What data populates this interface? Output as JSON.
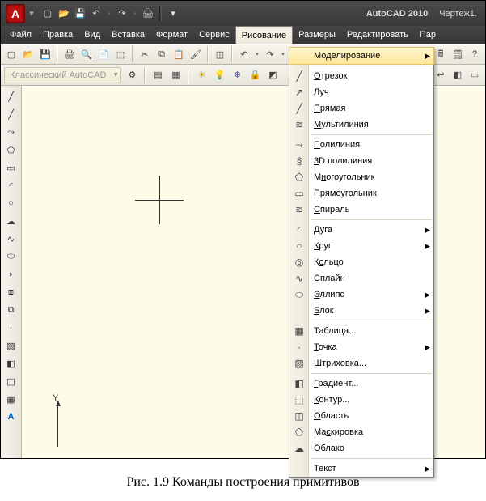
{
  "app_title": "AutoCAD 2010",
  "doc_title": "Чертеж1.",
  "qat": {
    "tooltip_dd": "▾"
  },
  "menu": {
    "items": [
      "Файл",
      "Правка",
      "Вид",
      "Вставка",
      "Формат",
      "Сервис",
      "Рисование",
      "Размеры",
      "Редактировать",
      "Пар"
    ],
    "open_index": 6
  },
  "workspace": {
    "selected": "Классический AutoCAD"
  },
  "dropdown": {
    "groups": [
      {
        "items": [
          {
            "label": "Моделирование",
            "icon": "",
            "submenu": true,
            "hover": true
          }
        ]
      },
      {
        "items": [
          {
            "label": "Отрезок",
            "u": 0,
            "icon": "╱"
          },
          {
            "label": "Луч",
            "u": 2,
            "icon": "↗"
          },
          {
            "label": "Прямая",
            "u": 0,
            "icon": "╱"
          },
          {
            "label": "Мультилиния",
            "u": 0,
            "icon": "≋"
          }
        ]
      },
      {
        "items": [
          {
            "label": "Полилиния",
            "u": 0,
            "icon": "⤳"
          },
          {
            "label": "3D полилиния",
            "u": 0,
            "icon": "§"
          },
          {
            "label": "Многоугольник",
            "u": 1,
            "icon": "⬠"
          },
          {
            "label": "Прямоугольник",
            "u": 2,
            "icon": "▭"
          },
          {
            "label": "Спираль",
            "u": 0,
            "icon": "≋"
          }
        ]
      },
      {
        "items": [
          {
            "label": "Дуга",
            "u": 0,
            "icon": "◜",
            "submenu": true
          },
          {
            "label": "Круг",
            "u": 0,
            "icon": "○",
            "submenu": true
          },
          {
            "label": "Кольцо",
            "u": 1,
            "icon": "◎"
          },
          {
            "label": "Сплайн",
            "u": 0,
            "icon": "∿"
          },
          {
            "label": "Эллипс",
            "u": 0,
            "icon": "⬭",
            "submenu": true
          },
          {
            "label": "Блок",
            "u": 0,
            "icon": "",
            "submenu": true
          }
        ]
      },
      {
        "items": [
          {
            "label": "Таблица...",
            "u": -1,
            "icon": "▦"
          },
          {
            "label": "Точка",
            "u": 0,
            "icon": "·",
            "submenu": true
          },
          {
            "label": "Штриховка...",
            "u": 0,
            "icon": "▨"
          }
        ]
      },
      {
        "items": [
          {
            "label": "Градиент...",
            "u": 0,
            "icon": "◧"
          },
          {
            "label": "Контур...",
            "u": 0,
            "icon": "⬚"
          },
          {
            "label": "Область",
            "u": 0,
            "icon": "◫"
          },
          {
            "label": "Маскировка",
            "u": 2,
            "icon": "⬠"
          },
          {
            "label": "Облако",
            "u": 2,
            "icon": "☁"
          }
        ]
      },
      {
        "items": [
          {
            "label": "Текст",
            "u": -1,
            "icon": "",
            "submenu": true
          }
        ]
      }
    ]
  },
  "ucs": {
    "y_label": "Y"
  },
  "caption": "Рис. 1.9 Команды построения примитивов"
}
